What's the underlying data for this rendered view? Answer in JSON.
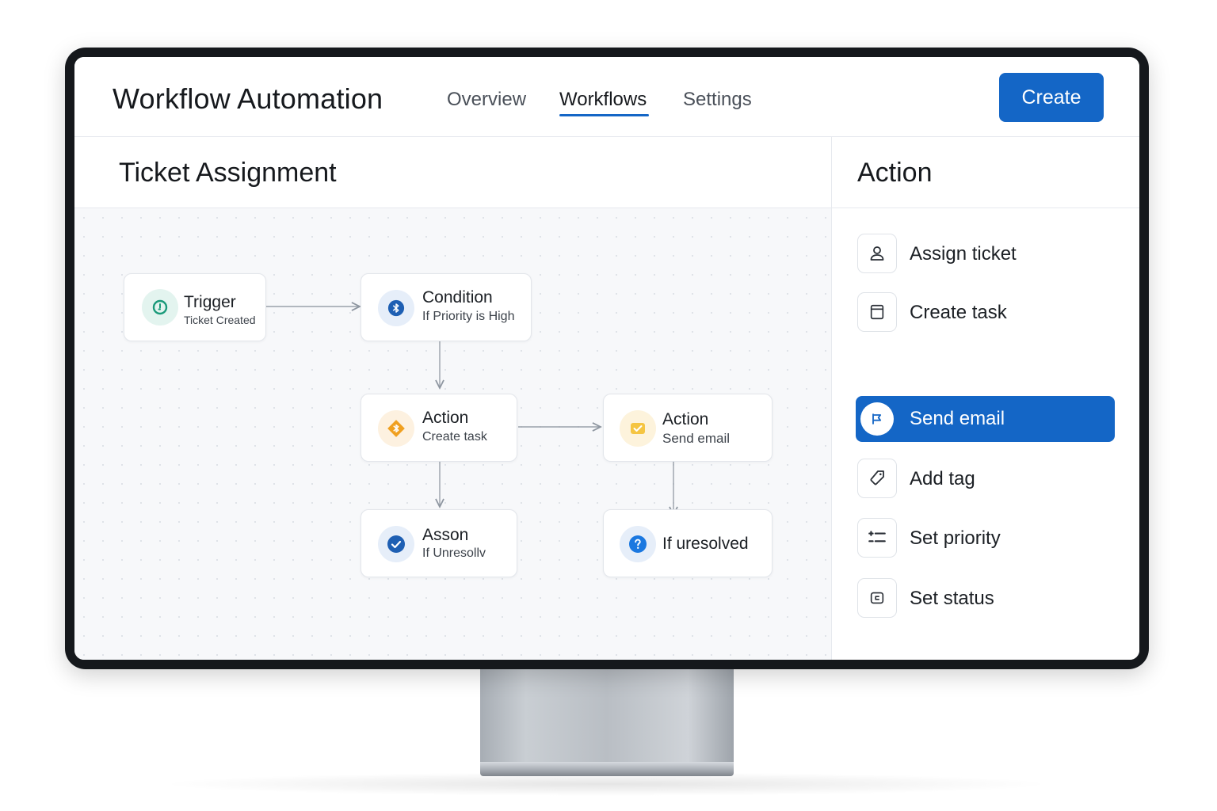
{
  "header": {
    "app_title": "Workflow Automation",
    "tabs": [
      {
        "label": "Overview",
        "active": false
      },
      {
        "label": "Workflows",
        "active": true
      },
      {
        "label": "Settings",
        "active": false
      }
    ],
    "create_label": "Create"
  },
  "canvas": {
    "title": "Ticket Assignment",
    "nodes": [
      {
        "title": "Trigger",
        "subtitle": "Ticket Created",
        "icon": "trigger-clock-icon",
        "color": "#1a9a7a"
      },
      {
        "title": "Condition",
        "subtitle": "If Priority is High",
        "icon": "bluetooth-icon",
        "color": "#1e5fb3"
      },
      {
        "title": "Action",
        "subtitle": "Create task",
        "icon": "bluetooth-diamond-icon",
        "color": "#f0a020"
      },
      {
        "title": "Action",
        "subtitle": "Send email",
        "icon": "checkmark-mail-icon",
        "color": "#f5c542"
      },
      {
        "title": "Asson",
        "subtitle": "If Unresollv",
        "icon": "check-circle-icon",
        "color": "#1e5fb3"
      },
      {
        "title": "If uresolved",
        "subtitle": "",
        "icon": "question-icon",
        "color": "#1b78e0"
      }
    ]
  },
  "panel": {
    "title": "Action",
    "items": [
      {
        "label": "Assign ticket",
        "icon": "user-icon",
        "selected": false
      },
      {
        "label": "Create task",
        "icon": "task-icon",
        "selected": false
      },
      {
        "label": "Send email",
        "icon": "flag-icon",
        "selected": true
      },
      {
        "label": "Add tag",
        "icon": "tag-icon",
        "selected": false
      },
      {
        "label": "Set priority",
        "icon": "priority-icon",
        "selected": false
      },
      {
        "label": "Set status",
        "icon": "status-icon",
        "selected": false
      }
    ]
  },
  "colors": {
    "accent": "#1466c6",
    "bezel": "#15181c",
    "canvas_bg": "#f7f8fa"
  }
}
